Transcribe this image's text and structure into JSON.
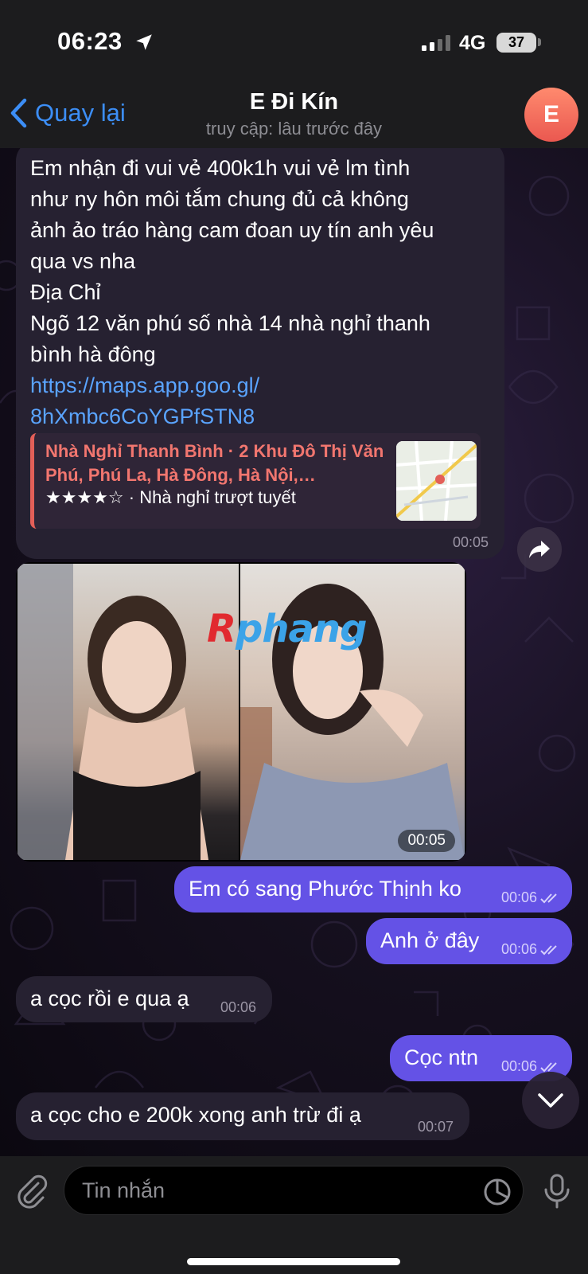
{
  "status_bar": {
    "time": "06:23",
    "network": "4G",
    "battery": "37"
  },
  "header": {
    "back_label": "Quay lại",
    "title": "E Đi Kín",
    "subtitle": "truy cập: lâu trước đây",
    "avatar_letter": "E"
  },
  "messages": [
    {
      "direction": "incoming",
      "lines": [
        "Em nhận đi vui vẻ 400k1h   vui vẻ  lm tình",
        "như ny  hôn môi tắm chung đủ cả  không",
        "ảnh ảo  tráo hàng cam đoan uy tín anh yêu",
        "qua vs  nha",
        "Địa Chỉ",
        "Ngõ 12 văn phú số nhà 14 nhà nghỉ thanh",
        "bình   hà đông"
      ],
      "link_lines": [
        "https://maps.app.goo.gl/",
        "8hXmbc6CoYGPfSTN8"
      ],
      "preview": {
        "title": "Nhà Nghỉ Thanh Bình · 2 Khu Đô Thị Văn Phú, Phú La, Hà Đông, Hà Nội,…",
        "stars": "★★★★☆",
        "description": "· Nhà nghỉ trượt tuyết"
      },
      "time": "00:05"
    },
    {
      "direction": "incoming",
      "type": "album",
      "watermark_a": "R",
      "watermark_b": "phang",
      "time": "00:05"
    },
    {
      "direction": "outgoing",
      "text": "Em có sang Phước Thịnh ko",
      "time": "00:06",
      "status": "read"
    },
    {
      "direction": "outgoing",
      "text": "Anh ở đây",
      "time": "00:06",
      "status": "read"
    },
    {
      "direction": "incoming",
      "text": "a cọc rồi e qua ạ",
      "time": "00:06"
    },
    {
      "direction": "outgoing",
      "text": "Cọc ntn",
      "time": "00:06",
      "status": "read"
    },
    {
      "direction": "incoming",
      "text": "a cọc cho e 200k xong anh trừ đi ạ",
      "time": "00:07"
    }
  ],
  "input": {
    "placeholder": "Tin nhắn"
  },
  "colors": {
    "accent": "#3c8ef6",
    "outgoing_bubble": "#6452e6",
    "incoming_bubble": "#262131",
    "link": "#5aa4ff",
    "preview_accent": "#e35f58"
  },
  "icons": [
    "location-arrow-icon",
    "signal-icon",
    "battery-icon",
    "back-chevron-icon",
    "forward-icon",
    "read-checks-icon",
    "scroll-down-icon",
    "attachment-icon",
    "sticker-icon",
    "microphone-icon"
  ]
}
